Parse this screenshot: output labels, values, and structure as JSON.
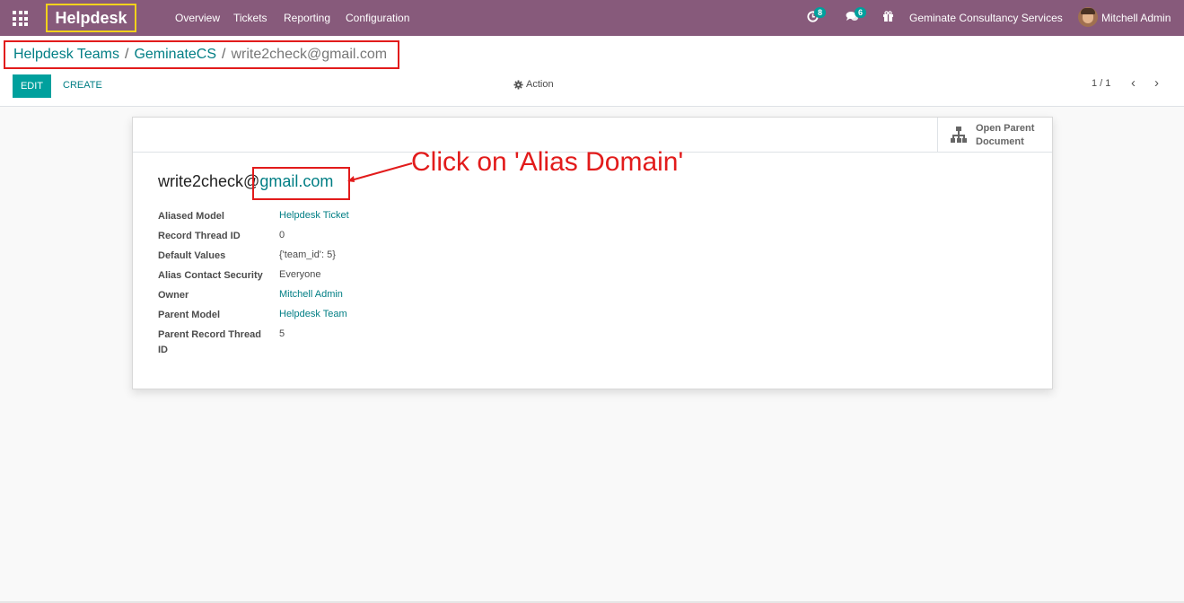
{
  "navbar": {
    "app_name": "Helpdesk",
    "menu": [
      "Overview",
      "Tickets",
      "Reporting",
      "Configuration"
    ],
    "activity_count": "8",
    "messages_count": "6",
    "company": "Geminate Consultancy Services",
    "user": "Mitchell Admin"
  },
  "breadcrumb": {
    "items": [
      "Helpdesk Teams",
      "GeminateCS",
      "write2check@gmail.com"
    ],
    "separator": "/"
  },
  "control": {
    "edit_label": "EDIT",
    "create_label": "CREATE",
    "action_label": "Action",
    "pager": "1 / 1"
  },
  "sheet": {
    "open_parent_label_1": "Open Parent",
    "open_parent_label_2": "Document",
    "alias_name": "write2check@",
    "alias_domain": "gmail.com",
    "fields": [
      {
        "label": "Aliased Model",
        "value": "Helpdesk Ticket"
      },
      {
        "label": "Record Thread ID",
        "value": "0"
      },
      {
        "label": "Default Values",
        "value": "{'team_id': 5}"
      },
      {
        "label": "Alias Contact Security",
        "value": "Everyone"
      },
      {
        "label": "Owner",
        "value": "Mitchell Admin"
      },
      {
        "label": "Parent Model",
        "value": "Helpdesk Team"
      },
      {
        "label": "Parent Record Thread ID",
        "value": "5"
      }
    ]
  },
  "annotation": {
    "text": "Click on 'Alias Domain'"
  },
  "colors": {
    "navbar": "#875a7b",
    "accent": "#00a09d",
    "link": "#017e84",
    "highlight_red": "#e21b1b",
    "highlight_yellow": "#f2d21b"
  }
}
